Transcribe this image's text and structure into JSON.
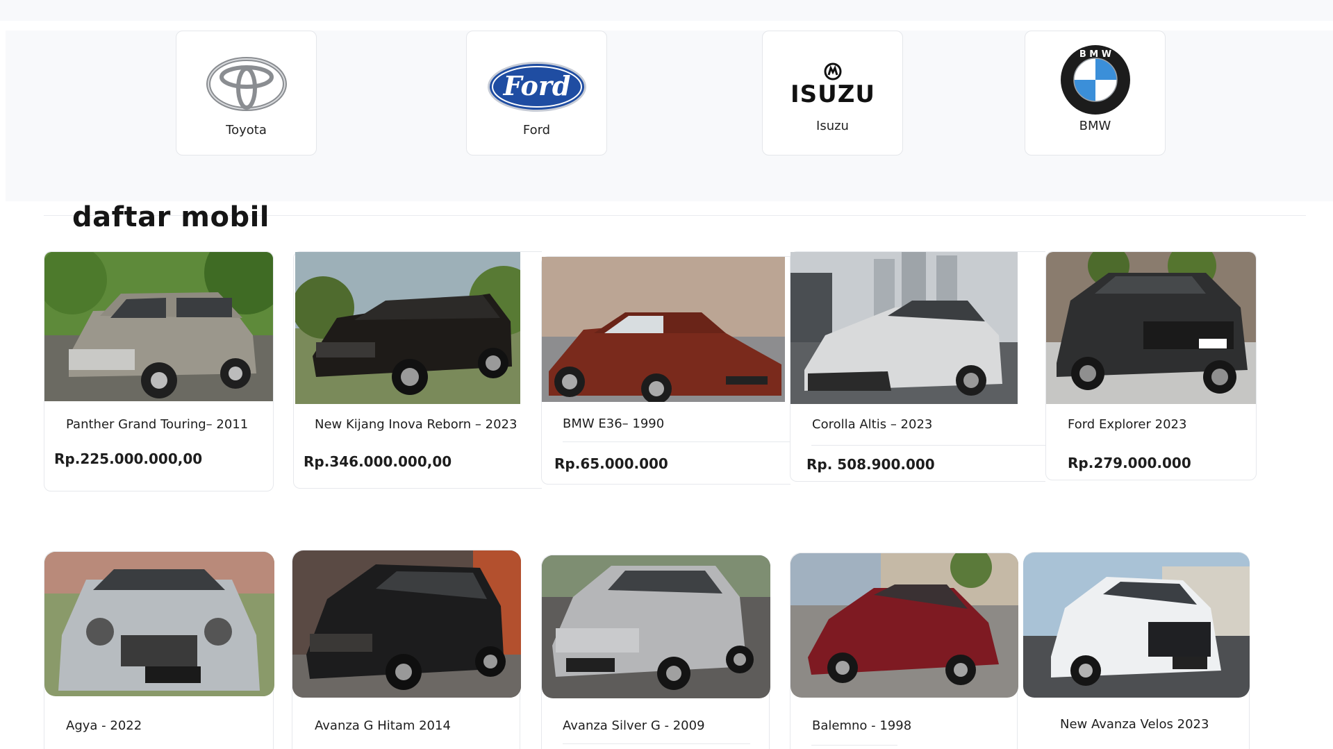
{
  "brands": [
    {
      "name": "Toyota"
    },
    {
      "name": "Ford",
      "logo_text": "Ford"
    },
    {
      "name": "Isuzu",
      "logo_text": "ISUZU"
    },
    {
      "name": "BMW",
      "logo_text": "B M W"
    }
  ],
  "section": {
    "title": "daftar mobil"
  },
  "cars": [
    {
      "name": "Panther Grand Touring– 2011",
      "price": "Rp.225.000.000,00"
    },
    {
      "name": "New Kijang Inova Reborn – 2023",
      "price": "Rp.346.000.000,00"
    },
    {
      "name": "BMW E36– 1990",
      "price": "Rp.65.000.000"
    },
    {
      "name": "Corolla Altis – 2023",
      "price": "Rp. 508.900.000"
    },
    {
      "name": "Ford Explorer 2023",
      "price": "Rp.279.000.000"
    },
    {
      "name": "Agya - 2022"
    },
    {
      "name": "Avanza G Hitam 2014"
    },
    {
      "name": "Avanza Silver G - 2009"
    },
    {
      "name": "Balemno - 1998"
    },
    {
      "name": "New Avanza Velos 2023"
    }
  ],
  "colors": {
    "background": "#ffffff",
    "strip": "#f8f9fb",
    "ford_blue": "#1f4da2",
    "bmw_blue": "#3b8fd9"
  }
}
